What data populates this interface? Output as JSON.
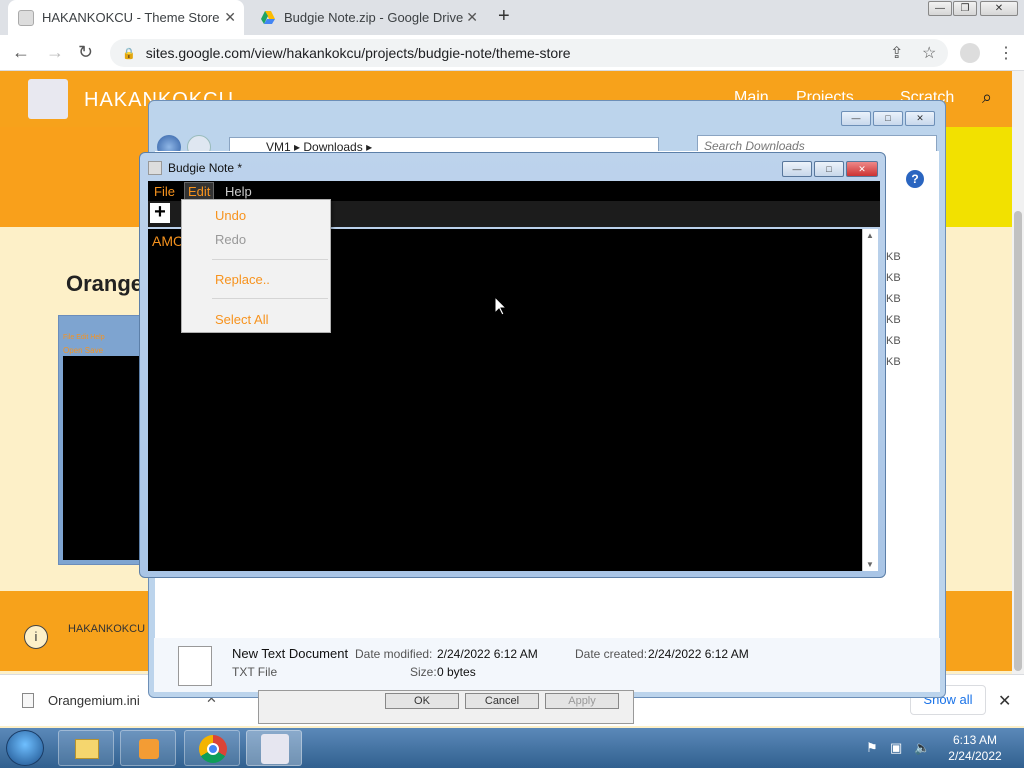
{
  "browser": {
    "tabs": [
      {
        "title": "HAKANKOKCU - Theme Store",
        "close": "✕"
      },
      {
        "title": "Budgie Note.zip - Google Drive",
        "close": "✕"
      }
    ],
    "new_tab": "+",
    "url": "sites.google.com/view/hakankokcu/projects/budgie-note/theme-store",
    "window_buttons": [
      "—",
      "❐",
      "✕"
    ]
  },
  "site": {
    "name": "HAKANKOKCU",
    "nav": [
      "Main",
      "Projects",
      "Scratch"
    ],
    "heading": "Orange",
    "preview_menu": "File  Edit  Help",
    "preview_toolbar": "Open Save",
    "footer_name": "HAKANKOKCU",
    "footer_icon": "i"
  },
  "download_shelf": {
    "file": "Orangemium.ini",
    "show_all": "Show all",
    "close": "✕"
  },
  "explorer": {
    "breadcrumb": "VM1  ▸  Downloads  ▸",
    "search_placeholder": "Search Downloads",
    "size_labels": [
      "KB",
      "KB",
      "KB",
      "KB",
      "KB",
      "KB"
    ],
    "details": {
      "name": "New Text Document",
      "type": "TXT File",
      "modified_label": "Date modified:",
      "modified_value": "2/24/2022 6:12 AM",
      "created_label": "Date created:",
      "created_value": "2/24/2022 6:12 AM",
      "size_label": "Size:",
      "size_value": "0 bytes"
    },
    "dialog_buttons": [
      "OK",
      "Cancel",
      "Apply"
    ]
  },
  "note": {
    "title": "Budgie Note *",
    "menus": [
      "File",
      "Edit",
      "Help"
    ],
    "editor_text": "AMO",
    "window_buttons": [
      "—",
      "□",
      "✕"
    ]
  },
  "edit_menu": {
    "items": [
      "Undo",
      "Redo",
      "Replace..",
      "Select All"
    ]
  },
  "taskbar": {
    "time": "6:13 AM",
    "date": "2/24/2022"
  },
  "colors": {
    "accent_orange": "#f7931e",
    "site_orange": "#f7a21b",
    "site_yellow": "#f2e100"
  }
}
